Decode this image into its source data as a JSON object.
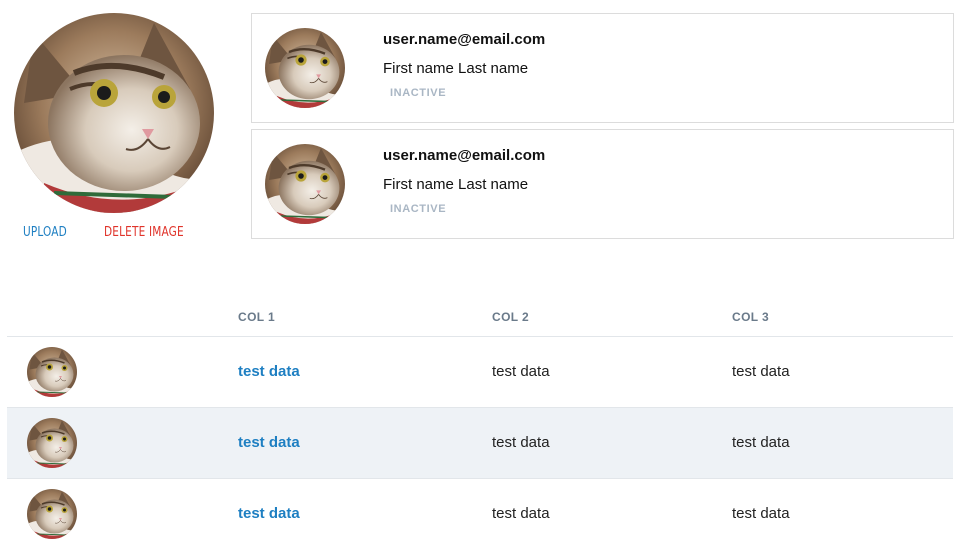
{
  "profile": {
    "avatar_icon": "cat-photo",
    "upload_label": "UPLOAD",
    "delete_label": "DELETE IMAGE"
  },
  "user_cards": [
    {
      "email": "user.name@email.com",
      "name": "First name Last name",
      "status": "INACTIVE"
    },
    {
      "email": "user.name@email.com",
      "name": "First name Last name",
      "status": "INACTIVE"
    }
  ],
  "table": {
    "columns": [
      "",
      "COL 1",
      "COL 2",
      "COL 3"
    ],
    "rows": [
      {
        "col1": "test data",
        "col2": "test data",
        "col3": "test data"
      },
      {
        "col1": "test data",
        "col2": "test data",
        "col3": "test data"
      },
      {
        "col1": "test data",
        "col2": "test data",
        "col3": "test data"
      }
    ]
  },
  "colors": {
    "link": "#1e7fc2",
    "danger": "#e0342b",
    "status_inactive": "#a9b6c4",
    "row_alt": "#eef2f6"
  }
}
